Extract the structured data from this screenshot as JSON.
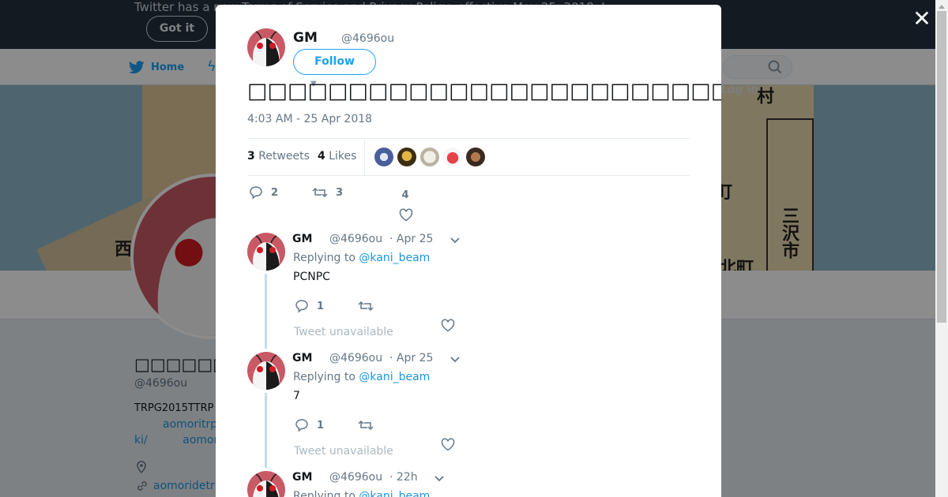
{
  "background": {
    "notice_text": "Twitter has a new Terms of Service and Privacy Policy, effective May 25, 2018. L",
    "got_it_label": "Got it",
    "nav_home_label": "Home",
    "login_label": "Log in",
    "map_labels": [
      "西",
      "村",
      "町",
      "三沢市",
      "北町"
    ],
    "profile_name": "□□□□□□□□",
    "profile_handle": "@4696ou",
    "profile_bio": "TRPG2015TTRP",
    "profile_link1": "aomoritrp",
    "profile_link2_a": "ki/",
    "profile_link2_b": "aomor",
    "profile_url": "aomoridetrp"
  },
  "modal": {
    "close_icon": "close-icon",
    "author": {
      "name": "GM",
      "handle": "@4696ou",
      "follow_label": "Follow"
    },
    "tweet_text": "□□□□□□□□□□□□□□□□□□□□□□□□□□□□□□□□□□□□□□□□□□□□□□□□□□□□□…□□□□□□□",
    "timestamp": "4:03 AM - 25 Apr 2018",
    "stats": {
      "retweets_count": "3",
      "retweets_label": "Retweets",
      "likes_count": "4",
      "likes_label": "Likes"
    },
    "actions": {
      "reply_count": "2",
      "retweet_count": "3",
      "like_count": "4"
    },
    "replies": [
      {
        "name": "GM",
        "handle": "@4696ou",
        "time": "· Apr 25",
        "replying_prefix": "Replying to",
        "replying_to": "@kani_beam",
        "text": "PCNPC",
        "reply_count": "1",
        "unavailable": "Tweet unavailable"
      },
      {
        "name": "GM",
        "handle": "@4696ou",
        "time": "· Apr 25",
        "replying_prefix": "Replying to",
        "replying_to": "@kani_beam",
        "text": "7",
        "reply_count": "1",
        "unavailable": "Tweet unavailable"
      },
      {
        "name": "GM",
        "handle": "@4696ou",
        "time": "· 22h",
        "replying_prefix": "Replying to",
        "replying_to": "@kani_beam"
      }
    ]
  },
  "colors": {
    "accent": "#1da1f2",
    "link": "#1b95e0",
    "muted": "#657786"
  }
}
